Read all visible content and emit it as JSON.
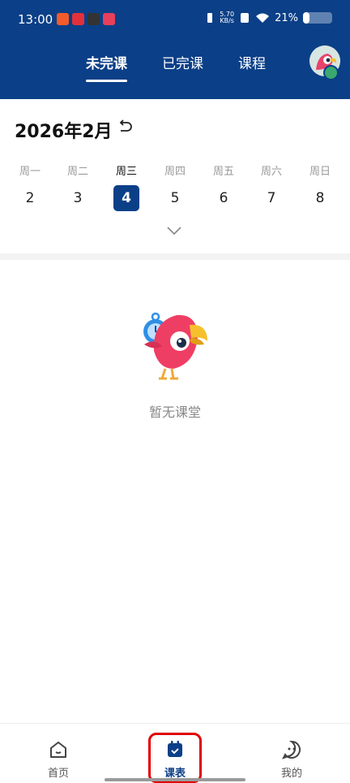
{
  "status_bar": {
    "time": "13:00",
    "net_speed_value": "5.70",
    "net_speed_unit": "KB/s",
    "battery": "21%",
    "battery_level": 0.21
  },
  "header": {
    "tabs": [
      {
        "label": "未完课",
        "active": true
      },
      {
        "label": "已完课",
        "active": false
      },
      {
        "label": "课程",
        "active": false
      }
    ],
    "accent_color": "#0b3f87"
  },
  "calendar": {
    "month_title": "2026年2月",
    "weekdays": [
      "周一",
      "周二",
      "周三",
      "周四",
      "周五",
      "周六",
      "周日"
    ],
    "dates": [
      "2",
      "3",
      "4",
      "5",
      "6",
      "7",
      "8"
    ],
    "selected_index": 2
  },
  "empty_state": {
    "message": "暂无课堂"
  },
  "bottom_nav": {
    "items": [
      {
        "label": "首页",
        "icon": "home-icon"
      },
      {
        "label": "课表",
        "icon": "calendar-icon",
        "active": true
      },
      {
        "label": "我的",
        "icon": "profile-face-icon"
      }
    ]
  }
}
